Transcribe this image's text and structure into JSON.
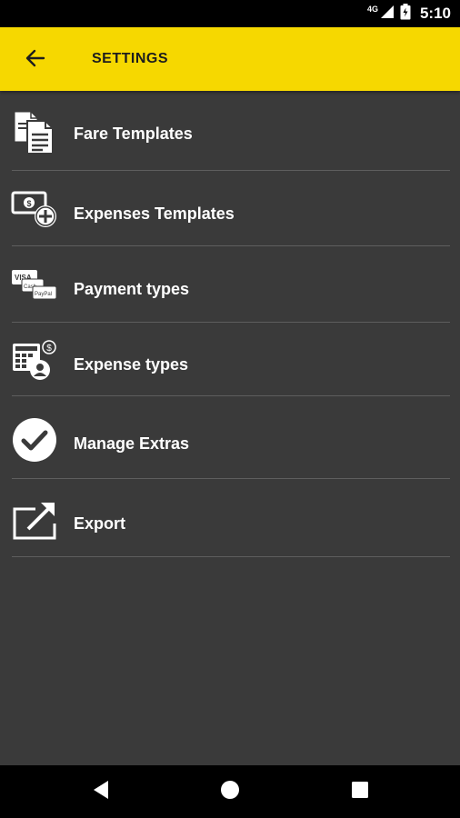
{
  "status_bar": {
    "network_label": "4G",
    "time": "5:10"
  },
  "app_bar": {
    "title": "SETTINGS",
    "back_icon": "arrow-left-icon"
  },
  "menu": {
    "items": [
      {
        "label": "Fare Templates",
        "icon": "documents-icon"
      },
      {
        "label": "Expenses Templates",
        "icon": "money-add-icon"
      },
      {
        "label": "Payment types",
        "icon": "payment-cards-icon",
        "card_labels": [
          "VISA",
          "Cash",
          "PayPal"
        ]
      },
      {
        "label": "Expense types",
        "icon": "calculator-dollar-icon"
      },
      {
        "label": "Manage Extras",
        "icon": "checkmark-circle-icon"
      },
      {
        "label": "Export",
        "icon": "export-icon"
      }
    ]
  },
  "colors": {
    "app_bar": "#f6d800",
    "background": "#3a3a3a",
    "divider": "#5e5e5e",
    "text": "#ffffff"
  }
}
